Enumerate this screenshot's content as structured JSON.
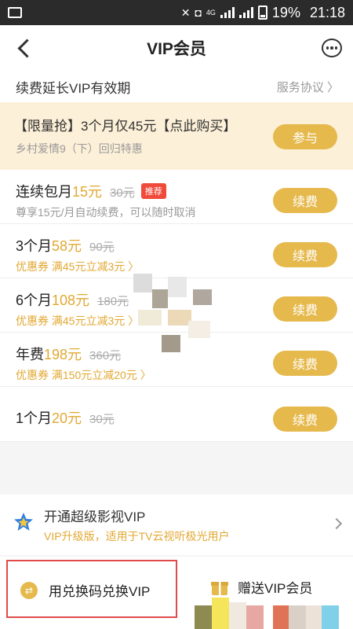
{
  "status_bar": {
    "battery": "19%",
    "time": "21:18",
    "network": "4G"
  },
  "header": {
    "title": "VIP会员"
  },
  "subheader": {
    "left": "续费延长VIP有效期",
    "right": "服务协议 〉"
  },
  "promo": {
    "title": "【限量抢】3个月仅45元【点此购买】",
    "subtitle": "乡村爱情9（下）回归特惠",
    "button": "参与"
  },
  "plans": [
    {
      "name": "连续包月",
      "price": "15元",
      "original": "30元",
      "tag": "推荐",
      "note": "尊享15元/月自动续费，可以随时取消",
      "note_type": "plain",
      "button": "续费"
    },
    {
      "name": "3个月",
      "price": "58元",
      "original": "90元",
      "note": "优惠券 满45元立减3元 〉",
      "note_type": "coupon",
      "button": "续费"
    },
    {
      "name": "6个月",
      "price": "108元",
      "original": "180元",
      "note": "优惠券 满45元立减3元 〉",
      "note_type": "coupon",
      "button": "续费"
    },
    {
      "name": "年费",
      "price": "198元",
      "original": "360元",
      "note": "优惠券 满150元立减20元 〉",
      "note_type": "coupon",
      "button": "续费"
    },
    {
      "name": "1个月",
      "price": "20元",
      "original": "30元",
      "button": "续费"
    }
  ],
  "super_vip": {
    "title": "开通超级影视VIP",
    "subtitle": "VIP升级版，适用于TV云视听极光用户"
  },
  "bottom": {
    "redeem": "用兑换码兑换VIP",
    "gift": "赠送VIP会员"
  },
  "colors": {
    "accent": "#e6b94d",
    "price": "#e2a833",
    "promo_bg": "#fdf0d8",
    "tag": "#f04a3a",
    "highlight_border": "#e04a4a"
  }
}
